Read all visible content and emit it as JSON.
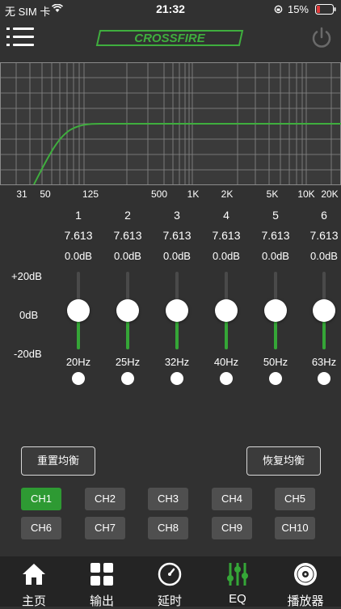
{
  "status": {
    "carrier": "无 SIM 卡",
    "time": "21:32",
    "battery": "15%"
  },
  "header": {
    "logo_text": "CROSSFIRE"
  },
  "freq_axis": [
    "31",
    "50",
    "125",
    "500",
    "1K",
    "2K",
    "5K",
    "10K",
    "20K"
  ],
  "gain_scale": {
    "top": "+20dB",
    "mid": "0dB",
    "bottom": "-20dB"
  },
  "bands": [
    {
      "index": "1",
      "q": "7.613",
      "gain": "0.0dB",
      "freq": "20Hz",
      "level": 0.5
    },
    {
      "index": "2",
      "q": "7.613",
      "gain": "0.0dB",
      "freq": "25Hz",
      "level": 0.5
    },
    {
      "index": "3",
      "q": "7.613",
      "gain": "0.0dB",
      "freq": "32Hz",
      "level": 0.5
    },
    {
      "index": "4",
      "q": "7.613",
      "gain": "0.0dB",
      "freq": "40Hz",
      "level": 0.5
    },
    {
      "index": "5",
      "q": "7.613",
      "gain": "0.0dB",
      "freq": "50Hz",
      "level": 0.5
    },
    {
      "index": "6",
      "q": "7.613",
      "gain": "0.0dB",
      "freq": "63Hz",
      "level": 0.5
    }
  ],
  "controls": {
    "reset": "重置均衡",
    "restore": "恢复均衡"
  },
  "channels": [
    "CH1",
    "CH2",
    "CH3",
    "CH4",
    "CH5",
    "CH6",
    "CH7",
    "CH8",
    "CH9",
    "CH10"
  ],
  "active_channel": "CH1",
  "tabs": [
    {
      "label": "主页",
      "icon": "home-icon"
    },
    {
      "label": "输出",
      "icon": "grid-icon"
    },
    {
      "label": "延时",
      "icon": "clock-icon"
    },
    {
      "label": "EQ",
      "icon": "equalizer-icon"
    },
    {
      "label": "播放器",
      "icon": "disc-icon"
    }
  ],
  "active_tab": "EQ",
  "colors": {
    "accent": "#35a637",
    "background": "#313131",
    "tabbar": "#242424"
  }
}
